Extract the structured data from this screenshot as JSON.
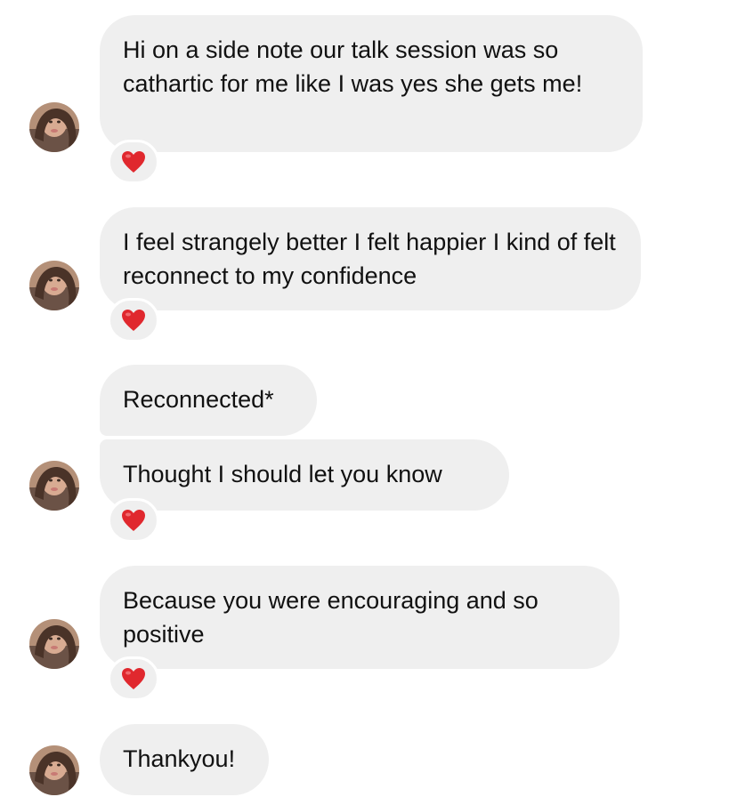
{
  "messages": [
    {
      "text": "Hi on a side note our talk session was so cathartic for me like I was yes she gets me!",
      "reaction": "heart-icon"
    },
    {
      "text": "I feel strangely better I felt happier I kind of felt reconnect to my confidence",
      "reaction": "heart-icon"
    },
    {
      "text": "Reconnected*"
    },
    {
      "text": "Thought I should let you know",
      "reaction": "heart-icon"
    },
    {
      "text": "Because you were encouraging and so positive",
      "reaction": "heart-icon"
    },
    {
      "text": "Thankyou!"
    }
  ],
  "colors": {
    "bubble_bg": "#efefef",
    "text": "#111111",
    "heart": "#e0282e"
  }
}
